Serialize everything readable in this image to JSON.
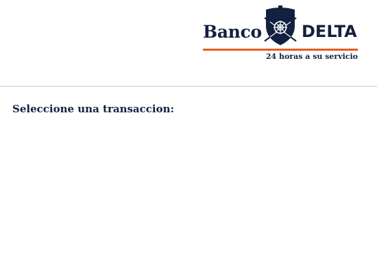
{
  "header": {
    "logo": {
      "brand_first": "Banco",
      "brand_second": "DELTA",
      "tagline": "24 horas a su servicio",
      "icon": "vault-shield-icon"
    }
  },
  "main": {
    "prompt": "Seleccione una transaccion:"
  },
  "colors": {
    "brand_navy": "#12213f",
    "accent_orange": "#e55a1b",
    "divider": "#e2e2e2",
    "background": "#ffffff"
  }
}
